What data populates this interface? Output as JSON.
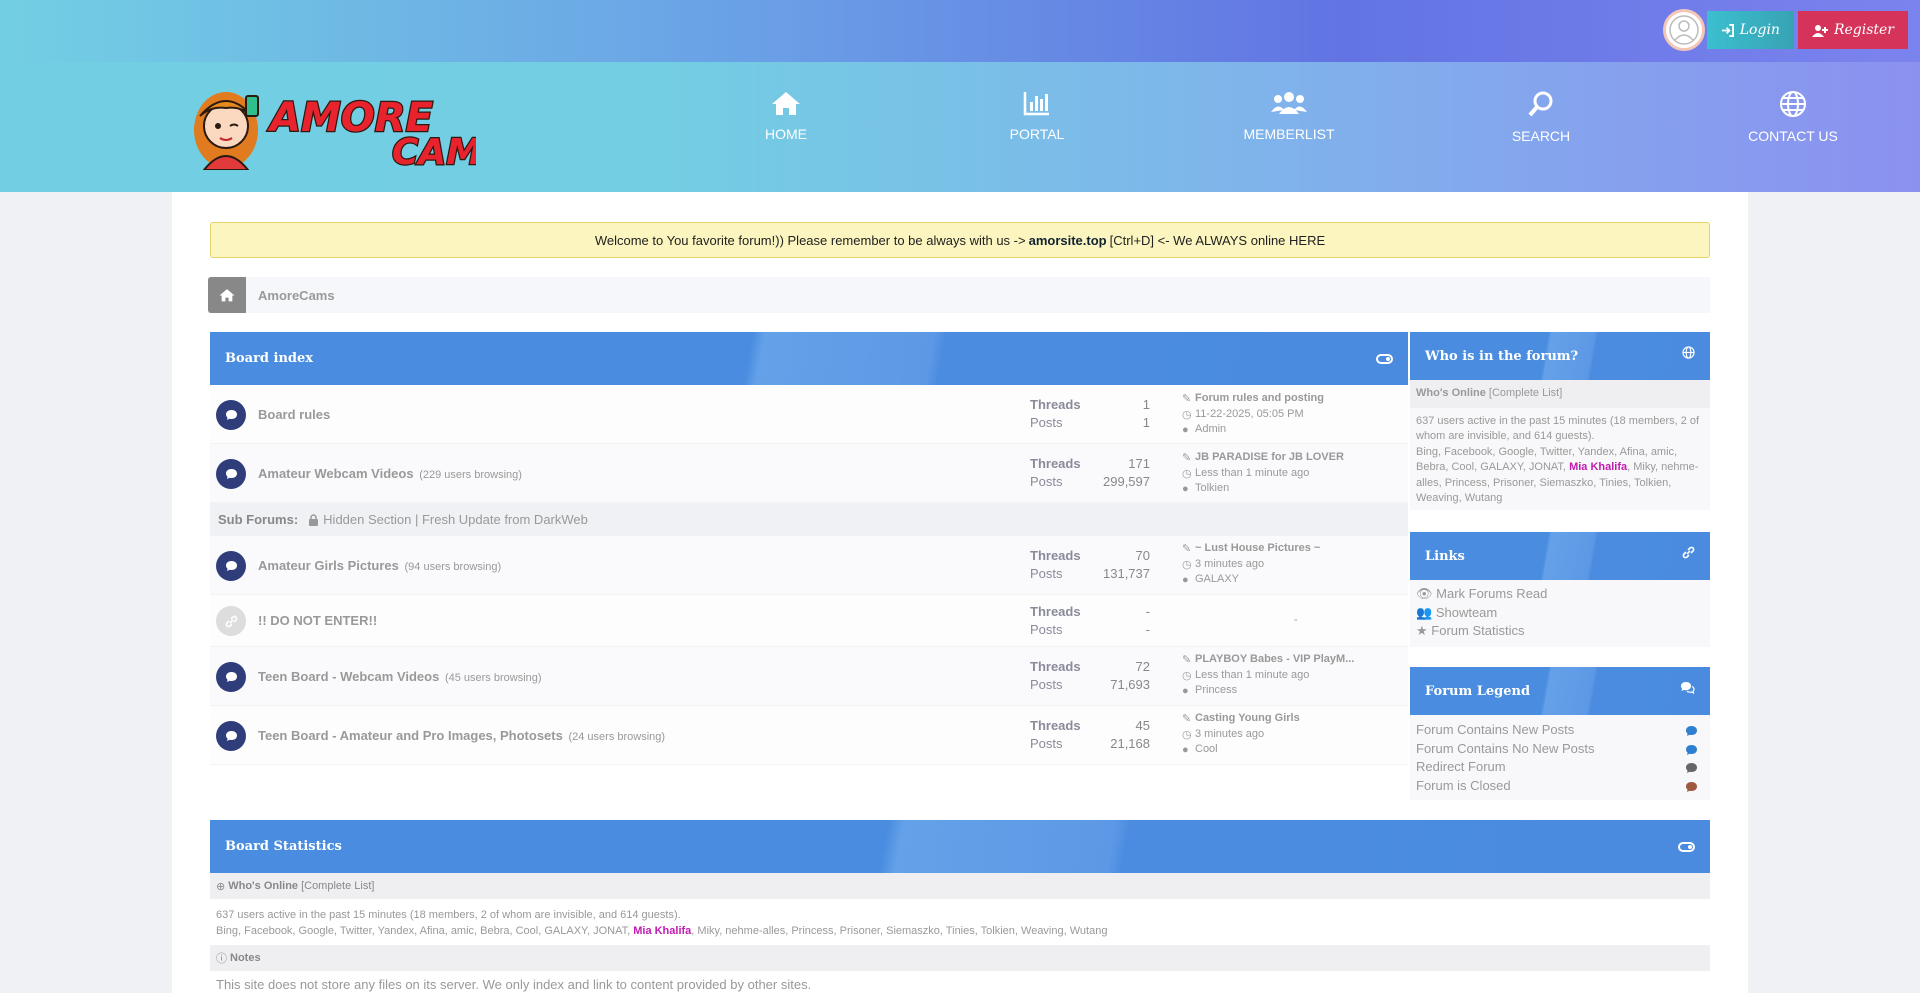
{
  "auth": {
    "login": "Login",
    "register": "Register"
  },
  "nav": [
    {
      "label": "HOME",
      "icon": "home-icon"
    },
    {
      "label": "PORTAL",
      "icon": "chart-icon"
    },
    {
      "label": "MEMBERLIST",
      "icon": "users-icon"
    },
    {
      "label": "SEARCH",
      "icon": "search-icon"
    },
    {
      "label": "CONTACT US",
      "icon": "globe-icon"
    }
  ],
  "logo": {
    "text1": "AMORE",
    "text2": "CAM"
  },
  "notice": {
    "before": "Welcome to You favorite forum!)) Please remember to be always with us ->",
    "link": "amorsite.top",
    "after": "[Ctrl+D] <- We ALWAYS online HERE"
  },
  "breadcrumb": {
    "label": "AmoreCams"
  },
  "board": {
    "title": "Board index",
    "labels": {
      "threads": "Threads",
      "posts": "Posts"
    },
    "forums": [
      {
        "title": "Board rules",
        "browsing": "",
        "threads": "1",
        "posts": "1",
        "last_title": "Forum rules and posting",
        "last_time": "11-22-2025, 05:05 PM",
        "last_user": "Admin"
      },
      {
        "title": "Amateur Webcam Videos",
        "browsing": "(229 users browsing)",
        "threads": "171",
        "posts": "299,597",
        "last_title": "JB PARADISE for JB LOVER",
        "last_time": "Less than 1 minute ago",
        "last_user": "Tolkien"
      },
      {
        "title": "Amateur Girls Pictures",
        "browsing": "(94 users browsing)",
        "threads": "70",
        "posts": "131,737",
        "last_title": "~ Lust House Pictures ~",
        "last_time": "3 minutes ago",
        "last_user": "GALAXY"
      },
      {
        "title": "!! DO NOT ENTER!!",
        "browsing": "",
        "threads": "-",
        "posts": "-",
        "last_title": "-",
        "last_time": "",
        "last_user": ""
      },
      {
        "title": "Teen Board - Webcam Videos",
        "browsing": "(45 users browsing)",
        "threads": "72",
        "posts": "71,693",
        "last_title": "PLAYBOY Babes - VIP PlayM...",
        "last_time": "Less than 1 minute ago",
        "last_user": "Princess"
      },
      {
        "title": "Teen Board - Amateur and Pro Images, Photosets",
        "browsing": "(24 users browsing)",
        "threads": "45",
        "posts": "21,168",
        "last_title": "Casting Young Girls",
        "last_time": "3 minutes ago",
        "last_user": "Cool"
      }
    ],
    "subforums_label": "Sub Forums:",
    "subforums_item": "Hidden Section | Fresh Update from DarkWeb"
  },
  "sidebar": {
    "online_title": "Who is in the forum?",
    "whos_online": "Who's Online",
    "complete_list": "[Complete List]",
    "active_text": "637 users active in the past 15 minutes (18 members, 2 of whom are invisible, and 614 guests).",
    "members_before": "Bing, Facebook, Google, Twitter, Yandex, Afina, amic, Bebra, Cool, GALAXY, JONAT,",
    "members_highlight": "Mia Khalifa",
    "members_after": ", Miky, nehme-alles, Princess, Prisoner, Siemaszko, Tinies, Tolkien, Weaving, Wutang",
    "links_title": "Links",
    "links": [
      "Mark Forums Read",
      "Showteam",
      "Forum Statistics"
    ],
    "legend_title": "Forum Legend",
    "legend": [
      "Forum Contains New Posts",
      "Forum Contains No New Posts",
      "Redirect Forum",
      "Forum is Closed"
    ],
    "legend_colors": [
      "#2f7fd0",
      "#2f7fd0",
      "#666666",
      "#a0573f"
    ]
  },
  "stats": {
    "title": "Board Statistics",
    "notes_label": "Notes",
    "notes_text": "This site does not store any files on its server. We only index and link to content provided by other sites."
  }
}
